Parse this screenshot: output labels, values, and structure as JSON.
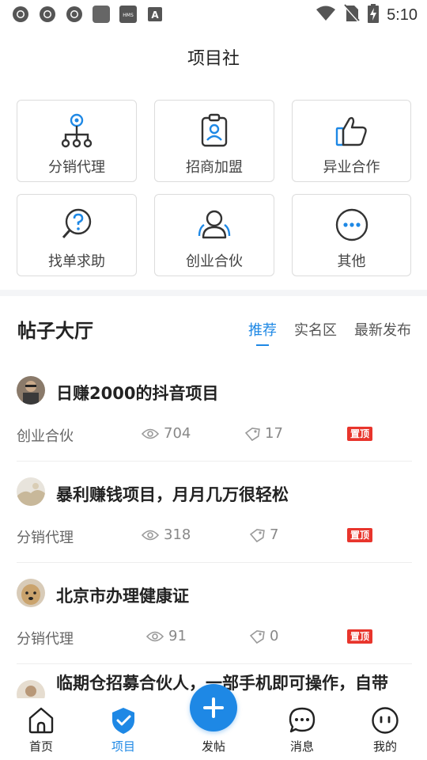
{
  "status_bar": {
    "time": "5:10",
    "notification_icons": [
      "chrome-icon",
      "chrome-icon",
      "chrome-icon",
      "app-square-icon",
      "hms-icon",
      "a-icon"
    ],
    "hms_text": "HMS",
    "a_text": "A"
  },
  "header": {
    "title": "项目社"
  },
  "categories": [
    {
      "label": "分销代理",
      "icon": "org-chart-icon"
    },
    {
      "label": "招商加盟",
      "icon": "badge-icon"
    },
    {
      "label": "异业合作",
      "icon": "thumbs-up-icon"
    },
    {
      "label": "找单求助",
      "icon": "help-icon"
    },
    {
      "label": "创业合伙",
      "icon": "partners-icon"
    },
    {
      "label": "其他",
      "icon": "more-icon"
    }
  ],
  "forum": {
    "title": "帖子大厅",
    "tabs": [
      {
        "label": "推荐",
        "active": true
      },
      {
        "label": "实名区",
        "active": false
      },
      {
        "label": "最新发布",
        "active": false
      }
    ]
  },
  "posts": [
    {
      "title": "日赚2000的抖音项目",
      "category": "创业合伙",
      "views": "704",
      "likes": "17",
      "badge": "置顶"
    },
    {
      "title": "暴利赚钱项目，月月几万很轻松",
      "category": "分销代理",
      "views": "318",
      "likes": "7",
      "badge": "置顶"
    },
    {
      "title": "北京市办理健康证",
      "category": "分销代理",
      "views": "91",
      "likes": "0",
      "badge": "置顶"
    },
    {
      "title": "临期仓招募合伙人，一部手机即可操作，自带",
      "category": "",
      "views": "",
      "likes": "",
      "badge": ""
    }
  ],
  "bottom_nav": {
    "items": [
      {
        "label": "首页",
        "icon": "home-icon",
        "active": false
      },
      {
        "label": "项目",
        "icon": "shield-check-icon",
        "active": true
      },
      {
        "label": "发帖",
        "icon": "plus-icon",
        "active": false
      },
      {
        "label": "消息",
        "icon": "chat-icon",
        "active": false
      },
      {
        "label": "我的",
        "icon": "profile-icon",
        "active": false
      }
    ]
  },
  "colors": {
    "accent": "#1e88e5",
    "badge": "#e8352c",
    "text": "#222222",
    "muted": "#888888"
  }
}
